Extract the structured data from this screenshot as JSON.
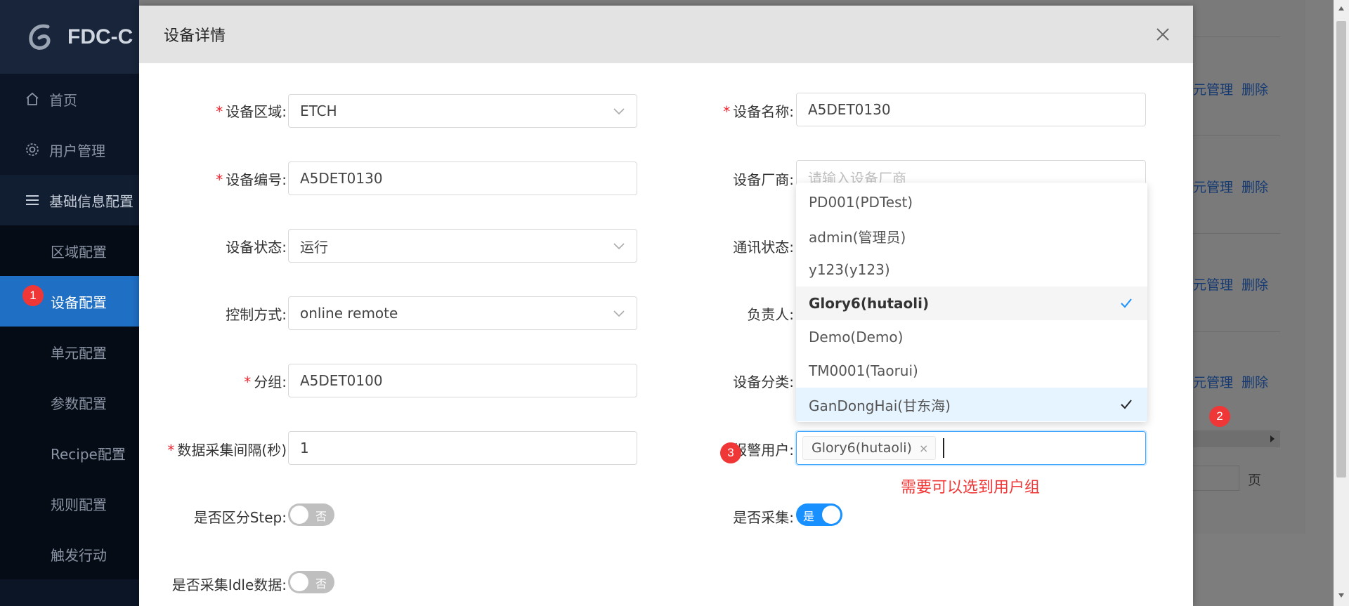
{
  "sidebar": {
    "logo_text": "FDC-C",
    "items": [
      {
        "label": "首页",
        "icon": "home-icon"
      },
      {
        "label": "用户管理",
        "icon": "gear-icon"
      },
      {
        "label": "基础信息配置",
        "icon": "menu-icon"
      }
    ],
    "sub_items": [
      {
        "label": "区域配置"
      },
      {
        "label": "设备配置"
      },
      {
        "label": "单元配置"
      },
      {
        "label": "参数配置"
      },
      {
        "label": "Recipe配置"
      },
      {
        "label": "规则配置"
      },
      {
        "label": "触发行动"
      }
    ],
    "active_sub": "设备配置"
  },
  "background": {
    "links": [
      {
        "manage": "元管理",
        "delete": "删除"
      },
      {
        "manage": "元管理",
        "delete": "删除"
      },
      {
        "manage": "元管理",
        "delete": "删除"
      },
      {
        "manage": "元管理",
        "delete": "删除"
      }
    ],
    "page_suffix": "页"
  },
  "annotations": {
    "badge1": "1",
    "badge2": "2",
    "badge3": "3",
    "note": "需要可以选到用户组"
  },
  "modal": {
    "title": "设备详情",
    "fields": {
      "area": {
        "label": "设备区域:",
        "value": "ETCH",
        "required": true
      },
      "name": {
        "label": "设备名称:",
        "value": "A5DET0130",
        "required": true
      },
      "code": {
        "label": "设备编号:",
        "value": "A5DET0130",
        "required": true
      },
      "vendor": {
        "label": "设备厂商:",
        "placeholder": "请输入设备厂商"
      },
      "status": {
        "label": "设备状态:",
        "value": "运行"
      },
      "comm": {
        "label": "通讯状态:"
      },
      "control": {
        "label": "控制方式:",
        "value": "online remote"
      },
      "owner": {
        "label": "负责人:"
      },
      "group": {
        "label": "分组:",
        "value": "A5DET0100",
        "required": true
      },
      "category": {
        "label": "设备分类:"
      },
      "interval": {
        "label": "数据采集间隔(秒)",
        "value": "1",
        "required": true
      },
      "alarm_users": {
        "label": "报警用户:",
        "tag": "Glory6(hutaoli)",
        "tag_close": "×"
      },
      "step": {
        "label": "是否区分Step:",
        "toggle_label": "否",
        "on": false
      },
      "collect": {
        "label": "是否采集:",
        "toggle_label": "是",
        "on": true
      },
      "idle": {
        "label": "是否采集Idle数据:",
        "toggle_label": "否",
        "on": false
      }
    }
  },
  "dropdown": {
    "options": [
      {
        "label": "PD001(PDTest)",
        "selected": false
      },
      {
        "label": "admin(管理员)",
        "selected": false
      },
      {
        "label": "y123(y123)",
        "selected": false
      },
      {
        "label": "Glory6(hutaoli)",
        "selected": true
      },
      {
        "label": "Demo(Demo)",
        "selected": false
      },
      {
        "label": "TM0001(Taorui)",
        "selected": false
      },
      {
        "label": "GanDongHai(甘东海)",
        "selected": true
      }
    ]
  },
  "colors": {
    "primary": "#1890ff",
    "required": "#f5222d",
    "annotation_red": "#f03737",
    "sidebar_active": "#1f6fc4"
  }
}
